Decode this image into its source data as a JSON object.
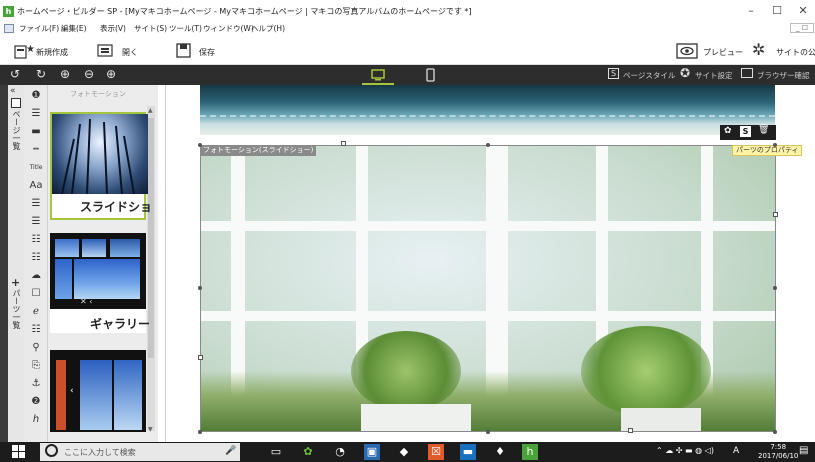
{
  "window": {
    "title": "ホームページ・ビルダー SP - [Myマキコホームページ - Myマキコホームページ | マキコの写真アルバムのホームページです *]",
    "app_icon": "hpb-app-icon",
    "min_glyph": "–",
    "max_glyph": "☐",
    "close_glyph": "✕"
  },
  "menu": {
    "items": [
      "ファイル(F)",
      "編集(E)",
      "表示(V)",
      "サイト(S)",
      "ツール(T)",
      "ウィンドウ(W)",
      "ヘルプ(H)"
    ],
    "mdi_restore": "_ ☐"
  },
  "toolbar": {
    "new_label": "新規作成",
    "open_label": "開く",
    "save_label": "保存",
    "preview_label": "プレビュー",
    "publish_label": "サイトの公開"
  },
  "darkbar": {
    "page_style_label": "ページスタイル",
    "site_settings_label": "サイト設定",
    "browser_check_label": "ブラウザー確認"
  },
  "left_tabs": {
    "pages_label": "ページ一覧",
    "parts_label": "パーツ一覧",
    "collapse_glyph": "«"
  },
  "tools": [
    "❶",
    "☰",
    "▬",
    "┅",
    "Title",
    "Aa",
    "☰",
    "☰",
    "☷",
    "☷",
    "☁",
    "☐",
    "ℯ",
    "☷",
    "⚲",
    "⎘",
    "⚓",
    "❷",
    "ℎ"
  ],
  "panel": {
    "title": "フォトモーション",
    "cards": [
      {
        "label": "スライドショ",
        "selected": true
      },
      {
        "label": "ギャラリー",
        "selected": false
      },
      {
        "label": "",
        "selected": false
      }
    ]
  },
  "canvas": {
    "slide_tag": "フォトモーション(スライドショー)",
    "parts_property": "パーツのプロパティ"
  },
  "taskbar": {
    "search_placeholder": "ここに入力して検索",
    "time": "7:58",
    "date": "2017/06/10",
    "ime": "A"
  },
  "colors": {
    "accent_green": "#a7c53a",
    "darkbar": "#2d2d2d",
    "taskbar": "#1c1c1c"
  }
}
